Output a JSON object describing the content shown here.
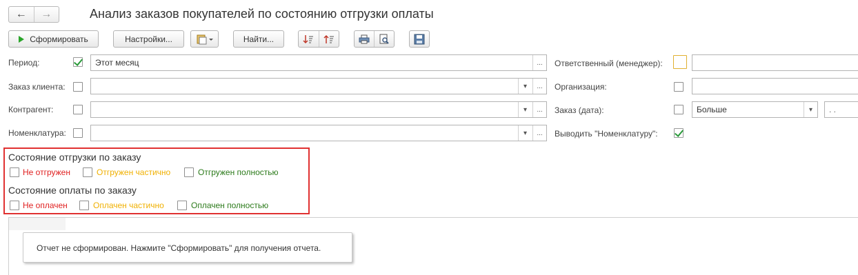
{
  "window": {
    "title": "Анализ заказов покупателей по состоянию отгрузки оплаты",
    "nav_back_icon": "arrow-left-icon",
    "nav_forward_icon": "arrow-right-icon"
  },
  "toolbar": {
    "generate_label": "Сформировать",
    "settings_label": "Настройки...",
    "find_label": "Найти...",
    "variant_icon": "report-variant-icon",
    "sort_asc_icon": "sort-ascending-icon",
    "sort_desc_icon": "sort-descending-icon",
    "print_icon": "printer-icon",
    "preview_icon": "print-preview-icon",
    "save_icon": "floppy-disk-icon"
  },
  "filters": {
    "period": {
      "label": "Период:",
      "checked": true,
      "value": "Этот месяц"
    },
    "order": {
      "label": "Заказ клиента:",
      "checked": false,
      "value": ""
    },
    "counterparty": {
      "label": "Контрагент:",
      "checked": false,
      "value": ""
    },
    "nomenclature": {
      "label": "Номенклатура:",
      "checked": false,
      "value": ""
    },
    "manager": {
      "label": "Ответственный (менеджер):",
      "checked": false,
      "value": ""
    },
    "organization": {
      "label": "Организация:",
      "checked": false,
      "value": ""
    },
    "order_date": {
      "label": "Заказ (дата):",
      "checked": false,
      "condition": "Больше",
      "date": ".  ."
    },
    "show_nomenclature": {
      "label": "Выводить \"Номенклатуру\":",
      "checked": true
    }
  },
  "shipment": {
    "title": "Состояние отгрузки по заказу",
    "options": [
      "Не отгружен",
      "Отгружен частично",
      "Отгружен полностью"
    ]
  },
  "payment": {
    "title": "Состояние оплаты по заказу",
    "options": [
      "Не оплачен",
      "Оплачен частично",
      "Оплачен полностью"
    ]
  },
  "report": {
    "message": "Отчет не сформирован. Нажмите \"Сформировать\" для получения отчета."
  },
  "colors": {
    "highlight_border": "#e03030",
    "status_red": "#e02020",
    "status_yellow": "#f0b000",
    "status_green": "#2b7a1a"
  }
}
